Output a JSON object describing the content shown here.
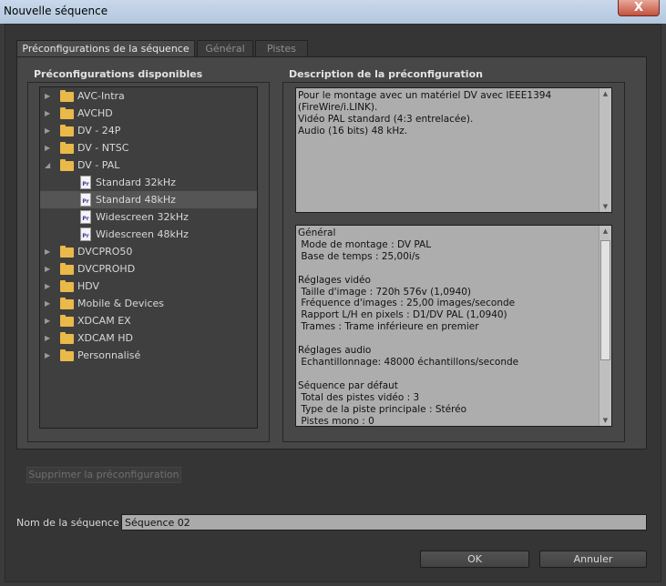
{
  "window": {
    "title": "Nouvelle séquence",
    "close_glyph": "X"
  },
  "tabs": [
    {
      "label": "Préconfigurations de la séquence",
      "active": true
    },
    {
      "label": "Général",
      "active": false
    },
    {
      "label": "Pistes",
      "active": false
    }
  ],
  "presets": {
    "title": "Préconfigurations disponibles",
    "items": [
      {
        "label": "AVC-Intra",
        "kind": "folder",
        "expanded": false
      },
      {
        "label": "AVCHD",
        "kind": "folder",
        "expanded": false
      },
      {
        "label": "DV - 24P",
        "kind": "folder",
        "expanded": false
      },
      {
        "label": "DV - NTSC",
        "kind": "folder",
        "expanded": false
      },
      {
        "label": "DV - PAL",
        "kind": "folder",
        "expanded": true
      },
      {
        "label": "Standard 32kHz",
        "kind": "preset",
        "selected": false
      },
      {
        "label": "Standard 48kHz",
        "kind": "preset",
        "selected": true
      },
      {
        "label": "Widescreen 32kHz",
        "kind": "preset",
        "selected": false
      },
      {
        "label": "Widescreen 48kHz",
        "kind": "preset",
        "selected": false
      },
      {
        "label": "DVCPRO50",
        "kind": "folder",
        "expanded": false
      },
      {
        "label": "DVCPROHD",
        "kind": "folder",
        "expanded": false
      },
      {
        "label": "HDV",
        "kind": "folder",
        "expanded": false
      },
      {
        "label": "Mobile & Devices",
        "kind": "folder",
        "expanded": false
      },
      {
        "label": "XDCAM EX",
        "kind": "folder",
        "expanded": false
      },
      {
        "label": "XDCAM HD",
        "kind": "folder",
        "expanded": false
      },
      {
        "label": "Personnalisé",
        "kind": "folder",
        "expanded": false
      }
    ],
    "file_badge": "Pr"
  },
  "description": {
    "title": "Description de la préconfiguration",
    "text": "Pour le montage avec un matériel DV avec IEEE1394\n(FireWire/i.LINK).\nVidéo PAL standard (4:3 entrelacée).\nAudio (16 bits) 48 kHz."
  },
  "details": {
    "text": "Général\n Mode de montage : DV PAL\n Base de temps : 25,00i/s\n\nRéglages vidéo\n Taille d'image : 720h 576v (1,0940)\n Fréquence d'images : 25,00 images/seconde\n Rapport L/H en pixels : D1/DV PAL (1,0940)\n Trames : Trame inférieure en premier\n\nRéglages audio\n Echantillonnage: 48000 échantillons/seconde\n\nSéquence par défaut\n Total des pistes vidéo : 3\n Type de la piste principale : Stéréo\n Pistes mono : 0"
  },
  "delete_button": {
    "label": "Supprimer la préconfiguration",
    "enabled": false
  },
  "sequence_name": {
    "label": "Nom de la séquence :",
    "value": "Séquence 02"
  },
  "buttons": {
    "ok": "OK",
    "cancel": "Annuler"
  },
  "colors": {
    "folder": "#e9b94a",
    "background": "#3b3b3b",
    "selected_row": "#555555"
  }
}
